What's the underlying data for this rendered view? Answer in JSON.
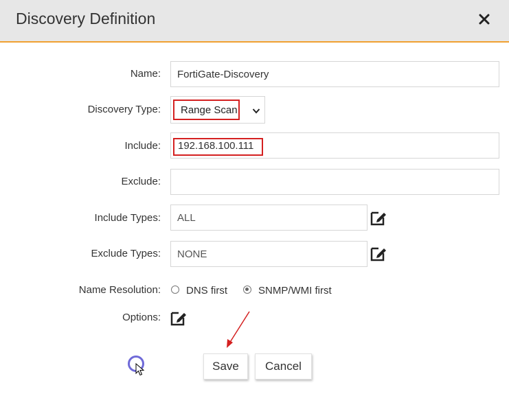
{
  "dialog": {
    "title": "Discovery Definition",
    "close_icon": "close-icon"
  },
  "form": {
    "name": {
      "label": "Name:",
      "value": "FortiGate-Discovery"
    },
    "discovery_type": {
      "label": "Discovery Type:",
      "value": "Range Scan"
    },
    "include": {
      "label": "Include:",
      "value": "192.168.100.111"
    },
    "exclude": {
      "label": "Exclude:",
      "value": ""
    },
    "include_types": {
      "label": "Include Types:",
      "value": "ALL"
    },
    "exclude_types": {
      "label": "Exclude Types:",
      "value": "NONE"
    },
    "name_resolution": {
      "label": "Name Resolution:",
      "options": [
        {
          "label": "DNS first",
          "selected": false
        },
        {
          "label": "SNMP/WMI first",
          "selected": true
        }
      ]
    },
    "options": {
      "label": "Options:"
    }
  },
  "buttons": {
    "save": "Save",
    "cancel": "Cancel"
  },
  "colors": {
    "title_bar": "#e7e7e7",
    "accent_line": "#f0a030",
    "highlight": "#d42020",
    "spinner": "#6f6ad8"
  }
}
